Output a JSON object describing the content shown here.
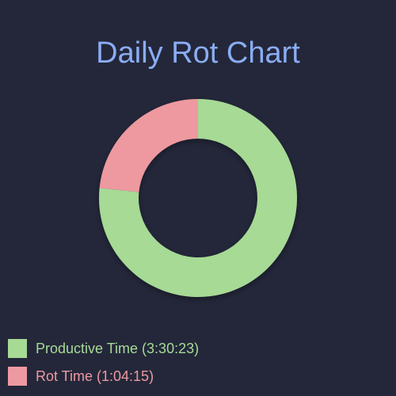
{
  "chart_data": {
    "type": "pie",
    "title": "Daily Rot Chart",
    "donut": true,
    "legend_position": "bottom-left",
    "categories": [
      "Productive Time (3:30:23)",
      "Rot Time (1:04:15)"
    ],
    "values": [
      12623,
      3855
    ],
    "value_labels": [
      "3:30:23",
      "1:04:15"
    ],
    "colors": [
      "#a6da95",
      "#ee99a0"
    ]
  },
  "colors": {
    "background": "#24273a",
    "title": "#8aadf4"
  }
}
